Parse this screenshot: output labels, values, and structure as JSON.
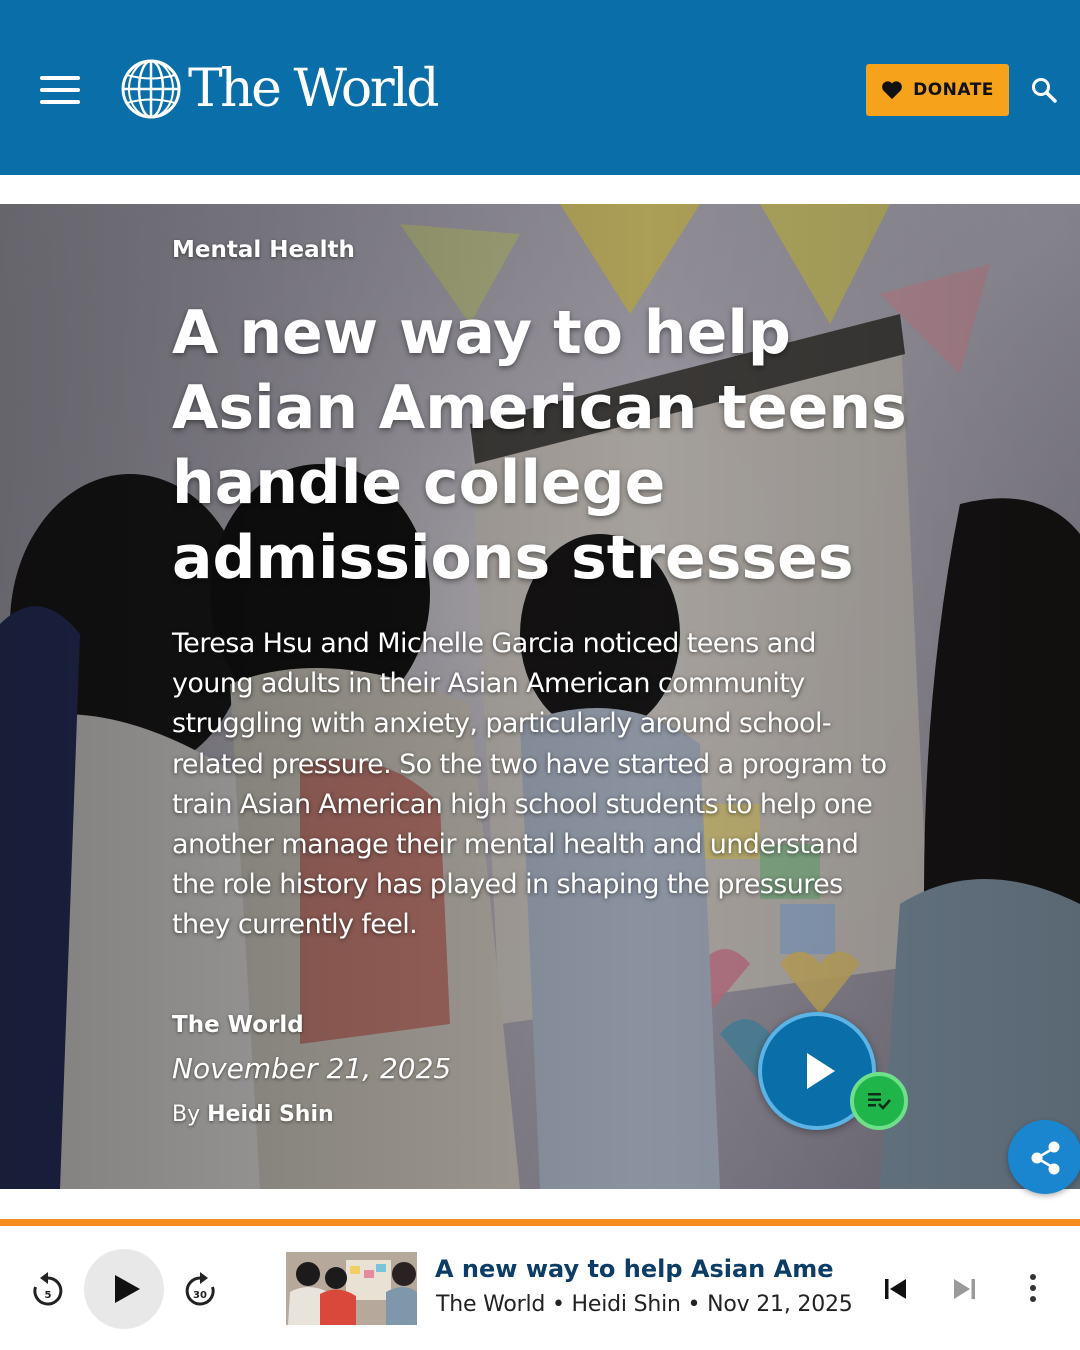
{
  "header": {
    "logo_text": "The World",
    "donate_label": "DONATE",
    "colors": {
      "background": "#0A6EA8",
      "donate": "#F6A21A"
    },
    "icons": [
      "menu-icon",
      "globe-icon",
      "heart-icon",
      "search-icon"
    ]
  },
  "article": {
    "category": "Mental Health",
    "headline": "A new way to help Asian American teens handle college admissions stresses",
    "dek": "Teresa Hsu and Michelle Garcia noticed teens and young adults in their Asian American community struggling with anxiety, particularly around school-related pressure. So the two have started a program to train Asian American high school students to help one another manage their mental health and understand the role history has played in shaping the pressures they currently feel.",
    "program": "The World",
    "date": "November 21, 2025",
    "by_prefix": "By",
    "author": "Heidi Shin",
    "icons": [
      "play-icon",
      "queue-added-icon",
      "share-icon"
    ]
  },
  "player": {
    "title": "A new way to help Asian American teens handle college admissions stresses",
    "meta": "The World • Heidi Shin • Nov 21, 2025",
    "rewind_seconds": "5",
    "forward_seconds": "30",
    "accent": "#F78B1F",
    "icons": [
      "rewind-icon",
      "play-icon",
      "forward-icon",
      "previous-icon",
      "next-icon",
      "more-icon"
    ]
  }
}
